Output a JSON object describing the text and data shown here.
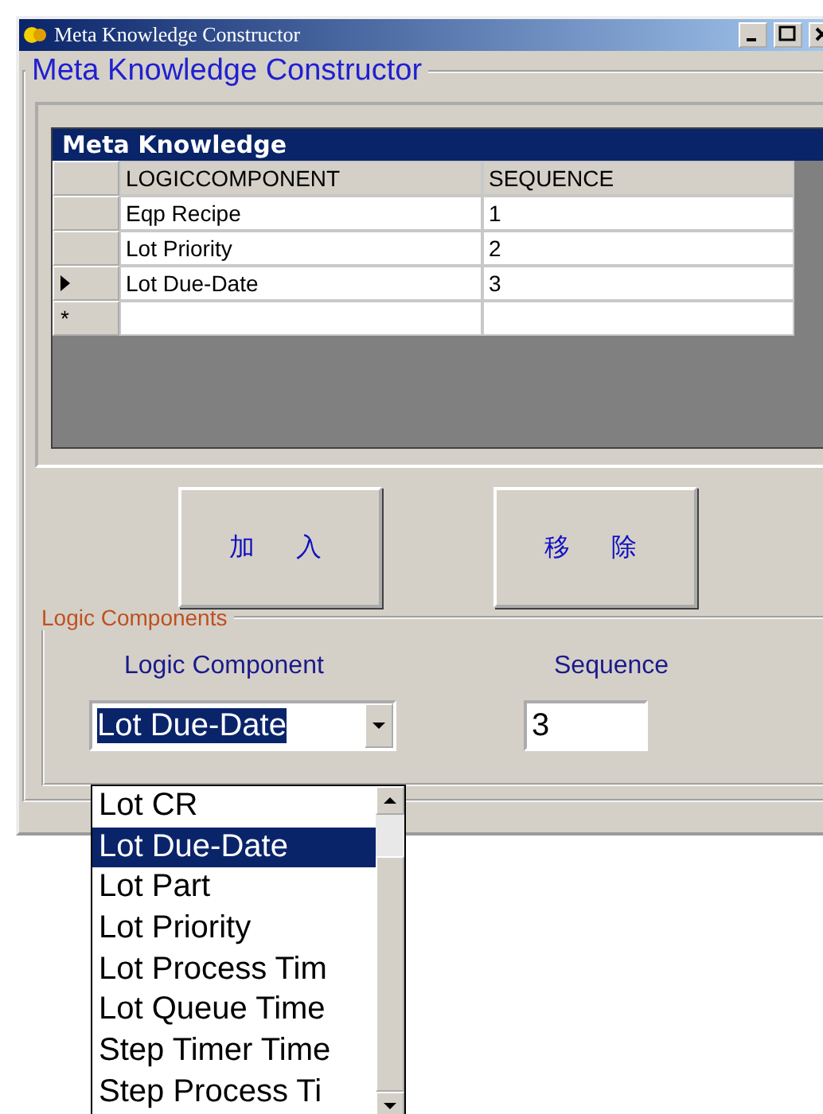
{
  "window": {
    "title": "Meta Knowledge Constructor"
  },
  "main_group": {
    "title": "Meta Knowledge Constructor"
  },
  "grid": {
    "caption": "Meta Knowledge",
    "columns": [
      "LOGICCOMPONENT",
      "SEQUENCE"
    ],
    "rows": [
      {
        "cells": [
          "Eqp Recipe",
          "1"
        ],
        "current": false
      },
      {
        "cells": [
          "Lot Priority",
          "2"
        ],
        "current": false
      },
      {
        "cells": [
          "Lot Due-Date",
          "3"
        ],
        "current": true
      }
    ],
    "new_row_marker": "*"
  },
  "buttons": [
    "加入",
    "移除"
  ],
  "logic_group": {
    "title": "Logic Components",
    "component_label": "Logic Component",
    "sequence_label": "Sequence",
    "component_value": "Lot Due-Date",
    "sequence_value": "3"
  },
  "dropdown": {
    "items": [
      {
        "label": "Lot CR",
        "selected": false
      },
      {
        "label": "Lot Due-Date",
        "selected": true
      },
      {
        "label": "Lot Part",
        "selected": false
      },
      {
        "label": "Lot Priority",
        "selected": false
      },
      {
        "label": "Lot Process Tim",
        "selected": false
      },
      {
        "label": "Lot Queue Time",
        "selected": false
      },
      {
        "label": "Step Timer Time",
        "selected": false
      },
      {
        "label": "Step Process Ti",
        "selected": false
      }
    ]
  }
}
